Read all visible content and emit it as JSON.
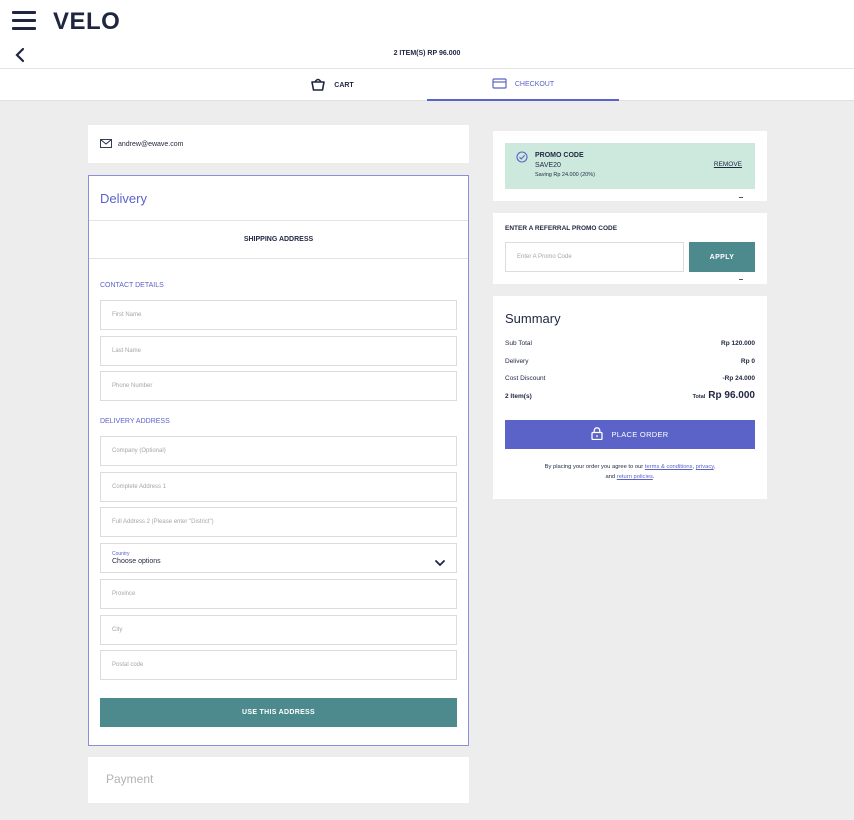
{
  "header": {
    "logo": "VELO",
    "cart_summary": "2 ITEM(S) RP 96.000"
  },
  "tabs": [
    {
      "label": "CART",
      "icon": "basket-icon"
    },
    {
      "label": "CHECKOUT",
      "icon": "card-icon",
      "active": true
    }
  ],
  "account": {
    "email": "andrew@ewave.com",
    "icon": "envelope-icon"
  },
  "delivery": {
    "title": "Delivery",
    "shipping_header": "SHIPPING ADDRESS",
    "contact_label": "CONTACT DETAILS",
    "contact_fields": [
      "First Name",
      "Last Name",
      "Phone Number"
    ],
    "address_label": "DELIVERY ADDRESS",
    "address_fields": [
      "Company (Optional)",
      "Complete Address 1",
      "Full Address 2 (Please enter \"District\")"
    ],
    "country": {
      "label": "Country",
      "value": "Choose options"
    },
    "region_fields": [
      "Province",
      "City",
      "Postal code"
    ],
    "submit_label": "USE THIS ADDRESS"
  },
  "payment": {
    "title": "Payment"
  },
  "promo": {
    "title": "PROMO CODE",
    "code": "SAVE20",
    "saving": "Saving Rp 24.000 (20%)",
    "remove_label": "REMOVE",
    "accent": "#cde9dd"
  },
  "referral": {
    "title": "ENTER A REFERRAL PROMO CODE",
    "placeholder": "Enter A Promo Code",
    "apply_label": "APPLY"
  },
  "summary": {
    "title": "Summary",
    "rows": [
      {
        "label": "Sub Total",
        "value": "Rp 120.000"
      },
      {
        "label": "Delivery",
        "value": "Rp 0"
      },
      {
        "label": "Cost Discount",
        "value": "-Rp 24.000"
      }
    ],
    "items_label": "2 Item(s)",
    "total_label": "Total",
    "total_value": "Rp 96.000",
    "place_order_label": "PLACE ORDER",
    "terms_prefix": "By placing your order you agree to our",
    "terms_link": "terms & conditions",
    "privacy_link": "privacy",
    "and_text": "and",
    "returns_link": "return policies"
  },
  "colors": {
    "brand": "#1f2640",
    "accent": "#5b63c8",
    "teal": "#4d8a8d",
    "background": "#ededed"
  }
}
